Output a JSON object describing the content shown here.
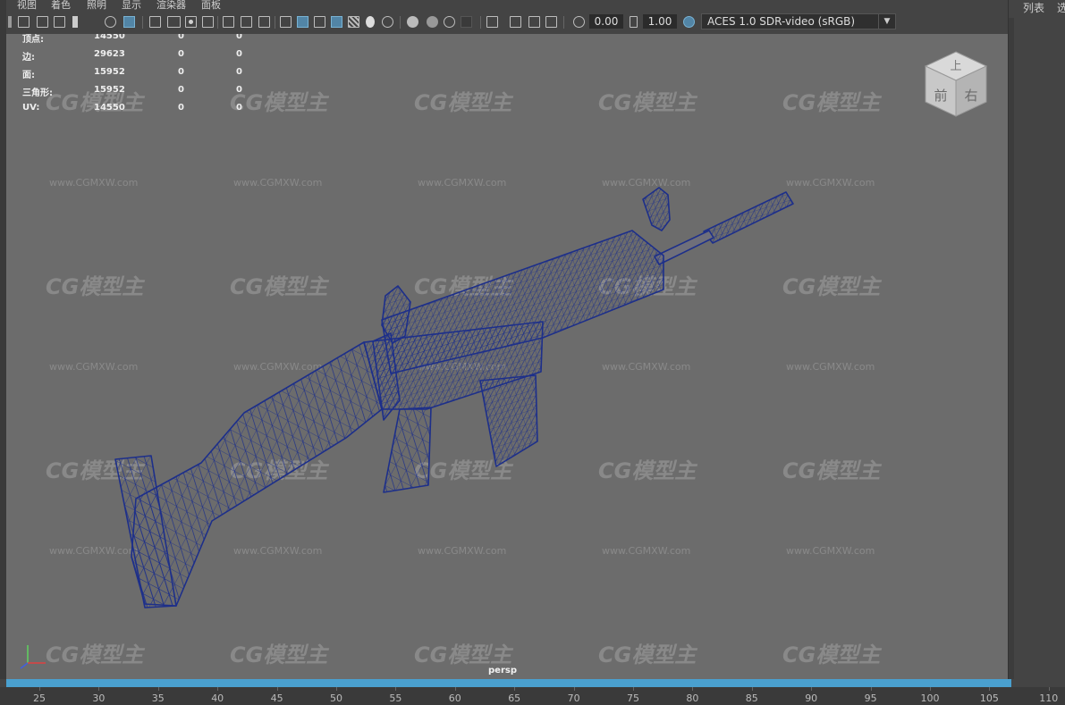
{
  "menu": [
    "视图",
    "着色",
    "照明",
    "显示",
    "渲染器",
    "面板"
  ],
  "toolbar": {
    "exposure_value": "0.00",
    "gamma_value": "1.00",
    "colorspace": "ACES 1.0 SDR-video (sRGB)"
  },
  "hud": {
    "rows": [
      {
        "label": "顶点:",
        "a": "14550",
        "b": "0",
        "c": "0"
      },
      {
        "label": "边:",
        "a": "29623",
        "b": "0",
        "c": "0"
      },
      {
        "label": "面:",
        "a": "15952",
        "b": "0",
        "c": "0"
      },
      {
        "label": "三角形:",
        "a": "15952",
        "b": "0",
        "c": "0"
      },
      {
        "label": "UV:",
        "a": "14550",
        "b": "0",
        "c": "0"
      }
    ]
  },
  "viewcube": {
    "top": "上",
    "front": "前",
    "right": "右"
  },
  "camera_label": "persp",
  "watermark": {
    "logo": "CG模型主",
    "url": "www.CGMXW.com"
  },
  "right_panel": {
    "tabs": [
      "列表",
      "选"
    ]
  },
  "timeline_ticks": [
    "25",
    "30",
    "35",
    "40",
    "45",
    "50",
    "55",
    "60",
    "65",
    "70",
    "75",
    "80",
    "85",
    "90",
    "95",
    "100",
    "105",
    "110"
  ],
  "colors": {
    "viewport_bg": "#6c6c6c",
    "wireframe": "#1d2f8a",
    "timeline_bar": "#4aa0cf",
    "active_tool": "#5285a6"
  },
  "icons": [
    "camera-icon",
    "film-icon",
    "grid-icon",
    "wireframe-cube-icon",
    "smooth-shaded-icon",
    "textured-icon",
    "light-icon",
    "shadow-icon",
    "xray-icon",
    "isolate-icon",
    "colorspace-icon"
  ]
}
